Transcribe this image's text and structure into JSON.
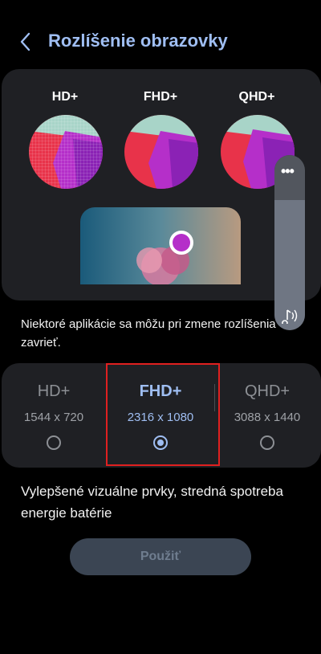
{
  "header": {
    "title": "Rozlíšenie obrazovky"
  },
  "preview": {
    "labels": [
      "HD+",
      "FHD+",
      "QHD+"
    ]
  },
  "note": "Niektoré aplikácie sa môžu pri zmene rozlíšenia zavrieť.",
  "options": [
    {
      "label": "HD+",
      "size": "1544 x 720",
      "selected": false
    },
    {
      "label": "FHD+",
      "size": "2316 x 1080",
      "selected": true
    },
    {
      "label": "QHD+",
      "size": "3088 x 1440",
      "selected": false
    }
  ],
  "description": "Vylepšené vizuálne prvky, stredná spotreba energie batérie",
  "apply_button": "Použiť",
  "volume": {
    "menu_icon": "more-icon",
    "icon": "music-note-icon"
  },
  "colors": {
    "accent": "#9fbef2",
    "highlight": "#e02020",
    "card": "#1f2024"
  }
}
